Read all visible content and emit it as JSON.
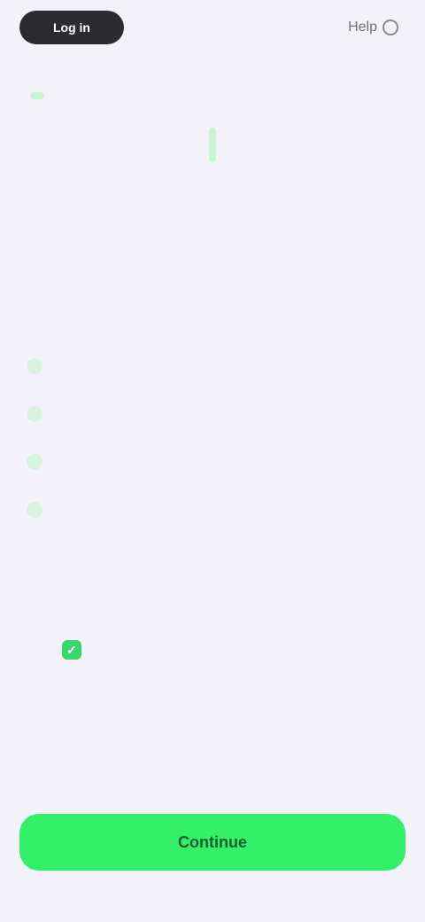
{
  "topbar": {
    "left_button_label": "Log in",
    "right_label": "Help"
  },
  "header": {
    "eyebrow": "",
    "title_highlight": "",
    "title_rest": "",
    "link_text": ""
  },
  "stats": {
    "caption": "",
    "values": [
      "",
      "",
      "",
      ""
    ],
    "footnote": ""
  },
  "features": [
    {
      "title": "",
      "desc": ""
    },
    {
      "title": "",
      "desc": ""
    },
    {
      "title": "",
      "desc": ""
    },
    {
      "title": "",
      "desc": ""
    }
  ],
  "consent": {
    "checked": true,
    "label": ""
  },
  "cta": {
    "label": "Continue"
  },
  "colors": {
    "background": "#f3f2fb",
    "accent_green": "#33f06a",
    "highlight_green": "#c9f3d3",
    "link_purple": "#9a80d6",
    "dark_button": "#2c2c30"
  }
}
